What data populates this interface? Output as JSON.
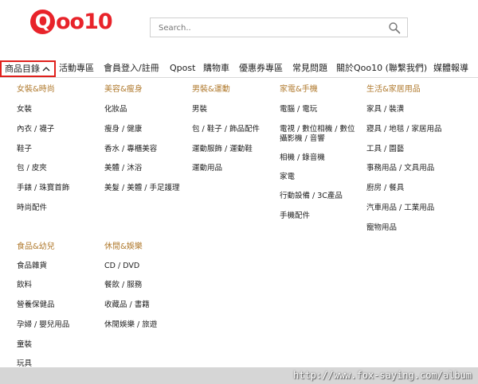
{
  "brand": {
    "logo_q": "Q",
    "logo_rest": "oo10"
  },
  "search": {
    "placeholder": "Search.."
  },
  "nav": [
    {
      "label": "商品目錄"
    },
    {
      "label": "活動專區"
    },
    {
      "label": "會員登入/註冊"
    },
    {
      "label": "Qpost"
    },
    {
      "label": "購物車"
    },
    {
      "label": "優惠券專區"
    },
    {
      "label": "常見問題"
    },
    {
      "label": "關於Qoo10 (聯繫我們)"
    },
    {
      "label": "媒體報導"
    }
  ],
  "categories": [
    {
      "heading": "女裝&時尚",
      "items": [
        "女裝",
        "內衣 / 襪子",
        "鞋子",
        "包 / 皮夾",
        "手錶 / 珠寶首飾",
        "時尚配件"
      ]
    },
    {
      "heading": "美容&瘦身",
      "items": [
        "化妝品",
        "瘦身 / 健康",
        "香水 / 專櫃美容",
        "美體 / 沐浴",
        "美髮 / 美體 / 手足護理"
      ]
    },
    {
      "heading": "男裝&運動",
      "items": [
        "男裝",
        "包 / 鞋子 / 飾品配件",
        "運動服飾 / 運動鞋",
        "運動用品"
      ]
    },
    {
      "heading": "家電&手機",
      "items": [
        "電腦 / 電玩",
        "電視 / 數位相機 / 數位",
        "攝影機 / 音響",
        "相機 / 錄音機",
        "家電",
        "行動設備 / 3C產品",
        "手機配件"
      ]
    },
    {
      "heading": "生活&家居用品",
      "items": [
        "家具 / 裝潢",
        "寢具 / 地毯 / 家居用品",
        "工具 / 園藝",
        "事務用品 / 文具用品",
        "廚房 / 餐具",
        "汽車用品 / 工業用品",
        "寵物用品"
      ]
    },
    {
      "heading": "食品&幼兒",
      "items": [
        "食品雜貨",
        "飲料",
        "營養保健品",
        "孕婦 / 嬰兒用品",
        "童裝",
        "玩具"
      ]
    },
    {
      "heading": "休閒&娛樂",
      "items": [
        "CD / DVD",
        "餐飲 / 服務",
        "收藏品 / 書籍",
        "休閒娛樂 / 旅遊"
      ]
    }
  ],
  "watermark": "http://www.fox-saying.com/album",
  "colors": {
    "brand": "#e8232a",
    "category_heading": "#b07a2e",
    "highlight": "#e0201c"
  }
}
